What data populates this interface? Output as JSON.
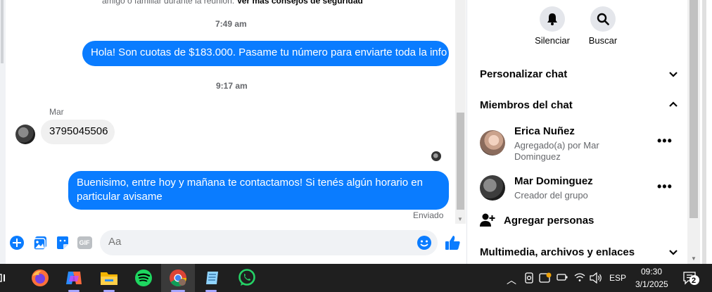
{
  "chat": {
    "top_partial_text": "amigo o familiar durante la reunión.",
    "top_partial_link": "Ver más consejos de seguridad",
    "timestamp1": "7:49 am",
    "message_out1": "Hola! Son cuotas de $183.000. Pasame tu número para enviarte toda la info",
    "timestamp2": "9:17 am",
    "sender_name": "Mar",
    "message_in1": "3795045506",
    "message_out2_line1": "Buenisimo, entre hoy y mañana te contactamos! Si tenés algún horario en",
    "message_out2_line2": "particular avisame",
    "status": "Enviado"
  },
  "composer": {
    "placeholder": "Aa",
    "gif_label": "GIF"
  },
  "panel": {
    "mute_label": "Silenciar",
    "search_label": "Buscar",
    "customize_chat": "Personalizar chat",
    "chat_members": "Miembros del chat",
    "members": [
      {
        "name": "Erica Nuñez",
        "sub_line1": "Agregado(a) por Mar",
        "sub_line2": "Dominguez"
      },
      {
        "name": "Mar Dominguez",
        "sub_line1": "Creador del grupo"
      }
    ],
    "add_people": "Agregar personas",
    "media_files_links": "Multimedia, archivos y enlaces"
  },
  "taskbar": {
    "language": "ESP",
    "time": "09:30",
    "date": "3/1/2025",
    "notification_count": "2"
  },
  "colors": {
    "messenger_blue": "#0a7cff",
    "incoming_bubble": "#f0f0f0",
    "taskbar_bg": "#1f1f1f"
  }
}
